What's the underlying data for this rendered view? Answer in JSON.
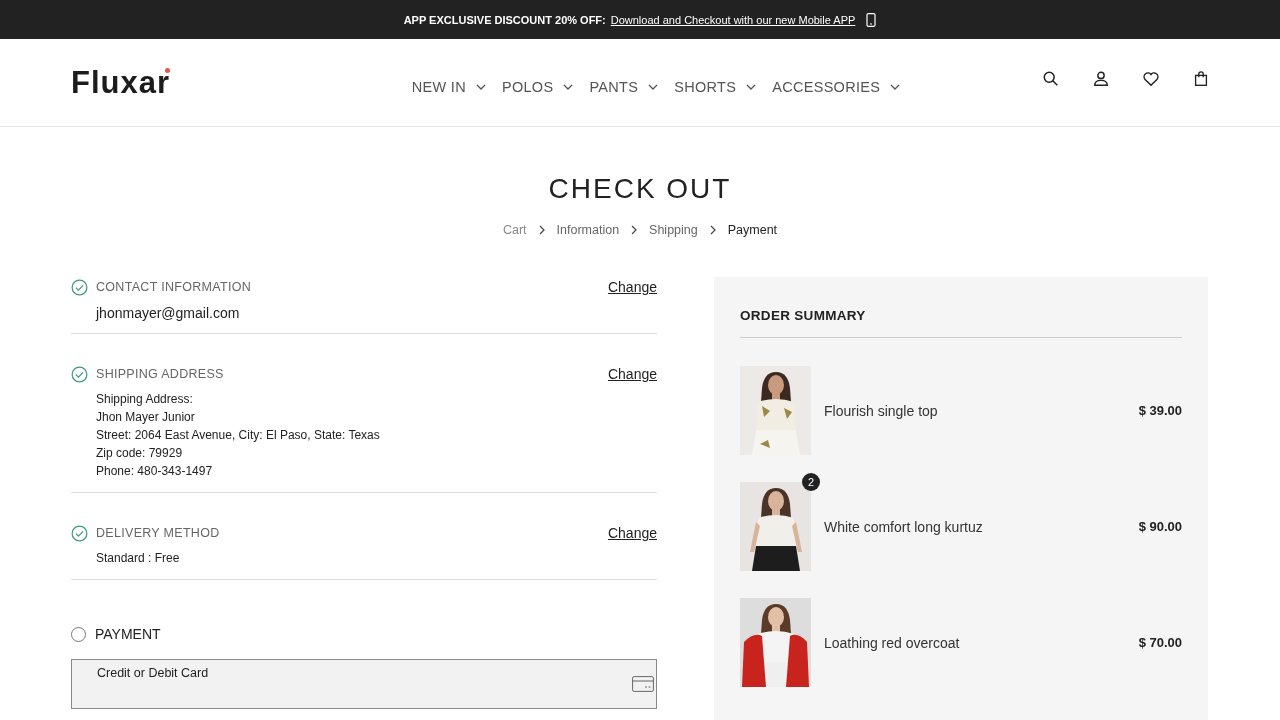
{
  "announcement": {
    "label": "APP EXCLUSIVE DISCOUNT 20% OFF:",
    "link": "Download and Checkout with our new Mobile APP"
  },
  "header": {
    "logo": "Fluxar",
    "nav": [
      {
        "label": "NEW IN"
      },
      {
        "label": "POLOS"
      },
      {
        "label": "PANTS"
      },
      {
        "label": "SHORTS"
      },
      {
        "label": "ACCESSORIES"
      }
    ]
  },
  "page_title": "CHECK OUT",
  "breadcrumb": [
    {
      "label": "Cart",
      "selected": false
    },
    {
      "label": "Information",
      "selected": false
    },
    {
      "label": "Shipping",
      "selected": false
    },
    {
      "label": "Payment",
      "selected": true
    }
  ],
  "sections": [
    {
      "title": "CONTACT INFORMATION",
      "done": true,
      "action": "Change",
      "lines": [
        "jhonmayer@gmail.com"
      ],
      "kind": "large"
    },
    {
      "title": "SHIPPING ADDRESS",
      "done": true,
      "action": "Change",
      "lines": [
        "Shipping Address:",
        "Jhon Mayer Junior",
        "Street: 2064 East Avenue, City: El Paso, State: Texas",
        "Zip code: 79929",
        "Phone: 480-343-1497"
      ],
      "kind": "small"
    },
    {
      "title": "DELIVERY METHOD",
      "done": true,
      "action": "Change",
      "lines": [
        "Standard : Free"
      ],
      "kind": "small"
    }
  ],
  "payment": {
    "title": "PAYMENT",
    "checked": false,
    "option": "Credit or Debit Card"
  },
  "order_summary": {
    "title": "ORDER SUMMARY",
    "items": [
      {
        "name": "Flourish single top",
        "price": "$ 39.00"
      },
      {
        "name": "White comfort long kurtuz",
        "price": "$ 90.00",
        "quantity": "2"
      },
      {
        "name": "Loathing red overcoat",
        "price": "$ 70.00"
      }
    ]
  }
}
